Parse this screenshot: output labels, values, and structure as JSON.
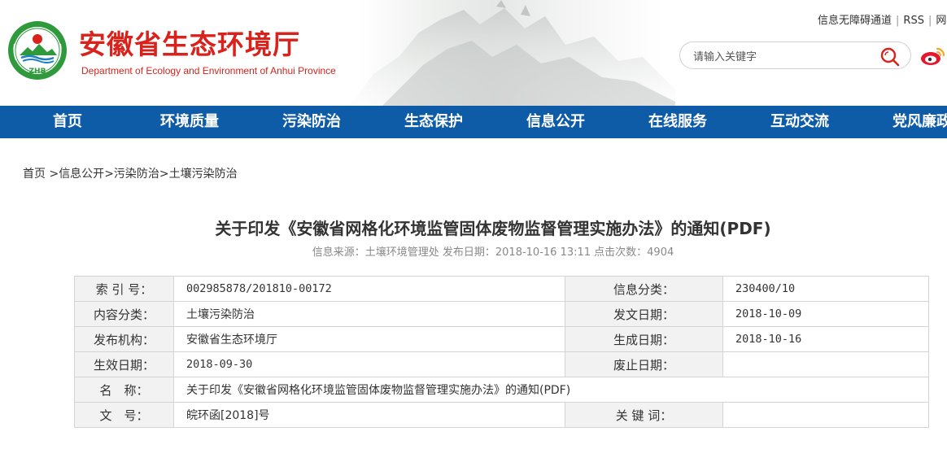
{
  "header": {
    "title": "安徽省生态环境厅",
    "subtitle": "Department of Ecology and Environment of Anhui Province",
    "logo_text": "ZHB",
    "top_links": [
      "信息无障碍通道",
      "RSS",
      "网"
    ],
    "search": {
      "placeholder": "请输入关键字"
    },
    "colors": {
      "brand_red": "#d8221b",
      "nav_blue": "#0e5ca7",
      "logo_green": "#2e9a3c"
    },
    "icons": [
      "logo-emblem",
      "search-icon",
      "weibo-icon"
    ]
  },
  "nav": {
    "items": [
      "首页",
      "环境质量",
      "污染防治",
      "生态保护",
      "信息公开",
      "在线服务",
      "互动交流",
      "党风廉政"
    ]
  },
  "breadcrumb": {
    "items": [
      "首页",
      "信息公开",
      "污染防治",
      "土壤污染防治"
    ],
    "separator": ">"
  },
  "article": {
    "title": "关于印发《安徽省网格化环境监管固体废物监督管理实施办法》的通知(PDF)",
    "meta": "信息来源：土壤环境管理处 发布日期：2018-10-16 13:11 点击次数：4904"
  },
  "info_table": {
    "index_no_label": "索 引 号：",
    "index_no": "002985878/201810-00172",
    "category_label": "信息分类：",
    "category": "230400/10",
    "content_type_label": "内容分类：",
    "content_type": "土壤污染防治",
    "issue_date_label": "发文日期：",
    "issue_date": "2018-10-09",
    "publisher_label": "发布机构：",
    "publisher": "安徽省生态环境厅",
    "created_date_label": "生成日期：",
    "created_date": "2018-10-16",
    "effective_date_label": "生效日期：",
    "effective_date": "2018-09-30",
    "repeal_date_label": "废止日期：",
    "repeal_date": "",
    "name_label": "名　称：",
    "name": "关于印发《安徽省网格化环境监管固体废物监督管理实施办法》的通知(PDF)",
    "doc_no_label": "文　号：",
    "doc_no": "皖环函[2018]号",
    "keywords_label": "关 键 词：",
    "keywords": ""
  }
}
